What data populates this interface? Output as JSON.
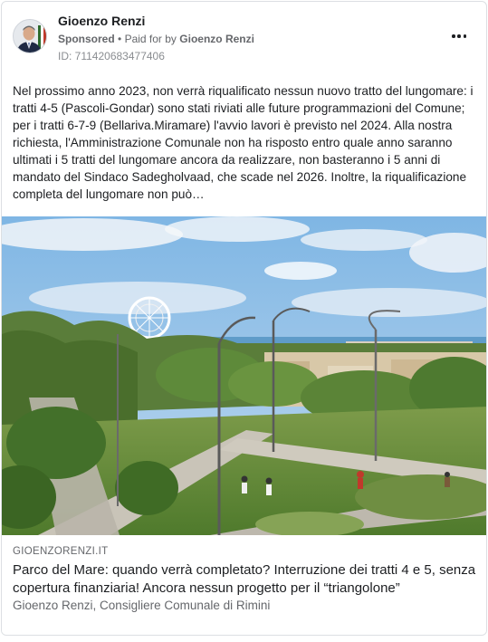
{
  "ad": {
    "page_name": "Gioenzo Renzi",
    "sponsored_label": "Sponsored",
    "separator": "•",
    "paid_for_label": "Paid for by",
    "paid_for_name": "Gioenzo Renzi",
    "ad_id": "ID: 711420683477406",
    "more_icon": "more-horizontal-icon"
  },
  "body": {
    "text": "Nel prossimo anno 2023, non verrà riqualificato nessun nuovo tratto del lungomare: i tratti 4-5 (Pascoli-Gondar) sono stati riviati alle future programmazioni del Comune; per i tratti 6-7-9 (Bellariva.Miramare) l'avvio lavori è previsto nel 2024. Alla nostra richiesta, l'Amministrazione Comunale non ha risposto entro quale anno saranno ultimati i 5 tratti del lungomare ancora da realizzare, non basteranno i 5 anni di mandato del Sindaco Sadegholvaad, che scade nel 2026. Inoltre, la riqualificazione completa del lungomare non può…"
  },
  "link": {
    "domain": "GIOENZORENZI.IT",
    "headline": "Parco del Mare: quando verrà completato? Interruzione dei tratti 4 e 5, senza copertura finanziaria! Ancora nessun progetto per il “triangolone”",
    "description": "Gioenzo Renzi, Consigliere Comunale di Rimini"
  },
  "colors": {
    "text_primary": "#1c1e21",
    "text_secondary": "#65676b",
    "border": "#dcdfe3"
  }
}
